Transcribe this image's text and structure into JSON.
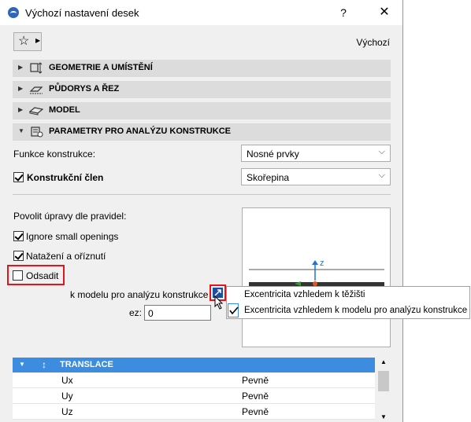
{
  "window": {
    "title": "Výchozí nastavení desek",
    "help": "?",
    "close": "✕"
  },
  "toolbar": {
    "favorites_icon": "star-icon",
    "preset_label": "Výchozí"
  },
  "sections": [
    {
      "label": "GEOMETRIE A UMÍSTĚNÍ",
      "expanded": false
    },
    {
      "label": "PŮDORYS A ŘEZ",
      "expanded": false
    },
    {
      "label": "MODEL",
      "expanded": false
    },
    {
      "label": "PARAMETRY PRO ANALÝZU KONSTRUKCE",
      "expanded": true
    }
  ],
  "structural": {
    "function_label": "Funkce konstrukce:",
    "function_value": "Nosné prvky",
    "member_label": "Konstrukční člen",
    "member_checked": true,
    "member_value": "Skořepina",
    "rules_label": "Povolit úpravy dle pravidel:",
    "ignore_small_openings": {
      "label": "Ignore small openings",
      "checked": true
    },
    "stretch_trim": {
      "label": "Natažení a oříznutí",
      "checked": true
    },
    "offset": {
      "label": "Odsadit",
      "checked": false
    },
    "eccentricity_label": "k modelu pro analýzu konstrukce",
    "ez_label": "ez:",
    "ez_value": "0",
    "preview_axis": "z"
  },
  "popup_menu": {
    "items": [
      {
        "label": "Excentricita vzhledem k těžišti",
        "checked": false
      },
      {
        "label": "Excentricita vzhledem k modelu pro analýzu konstrukce",
        "checked": true
      }
    ]
  },
  "table": {
    "group_label": "TRANSLACE",
    "rows": [
      {
        "name": "Ux",
        "value": "Pevně"
      },
      {
        "name": "Uy",
        "value": "Pevně"
      },
      {
        "name": "Uz",
        "value": "Pevně"
      }
    ]
  },
  "colors": {
    "highlight_red": "#e0161c",
    "selection_blue": "#3c8ce0",
    "axis_blue": "#1e73d8"
  }
}
